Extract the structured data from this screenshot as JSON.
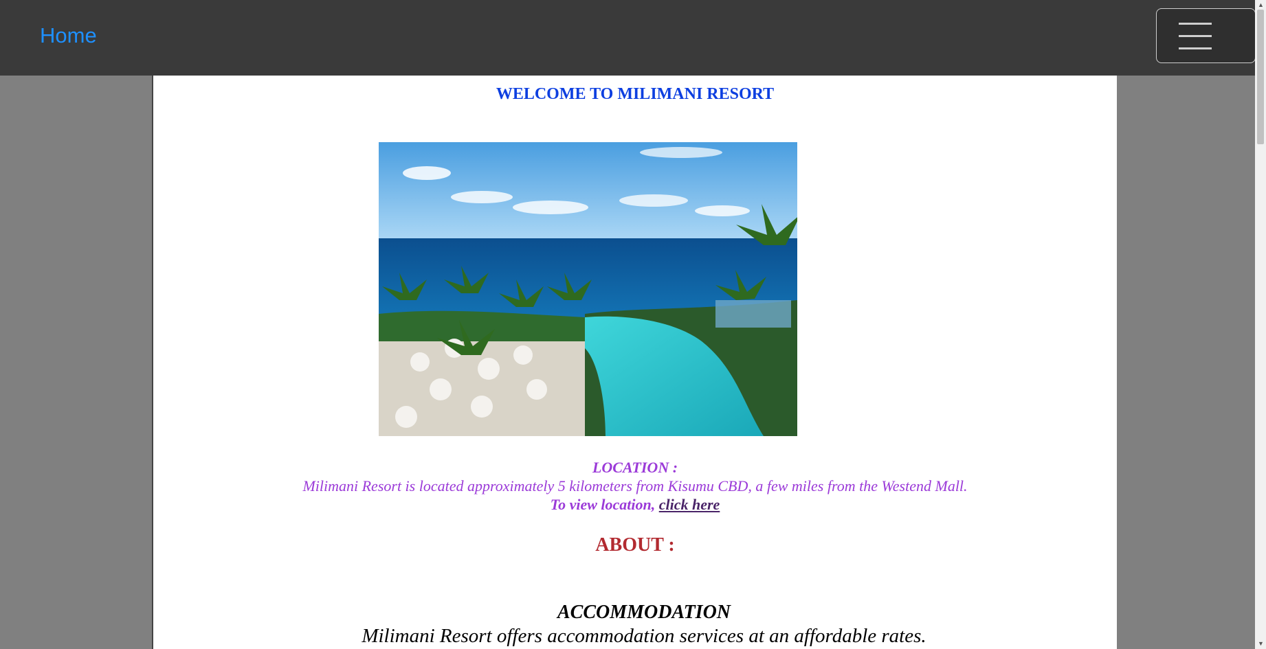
{
  "navbar": {
    "home_label": "Home",
    "toggler_icon": "hamburger-menu-icon"
  },
  "content": {
    "welcome_title": "WELCOME TO MILIMANI RESORT",
    "hero_image_alt": "resort-pool-ocean-image",
    "location": {
      "title": "LOCATION :",
      "text": "Milimani Resort is located approximately 5 kilometers from Kisumu CBD, a few miles from the Westend Mall.",
      "link_prefix": "To view location, ",
      "link_label": "click here"
    },
    "about_title": "ABOUT :",
    "accommodation": {
      "title": "ACCOMMODATION",
      "text": "Milimani Resort offers accommodation services at an affordable rates."
    }
  },
  "colors": {
    "navbar_bg": "#3a3a3a",
    "home_link": "#1e90ff",
    "welcome": "#0d3fe0",
    "location": "#9b3ad8",
    "about": "#b22a30"
  }
}
